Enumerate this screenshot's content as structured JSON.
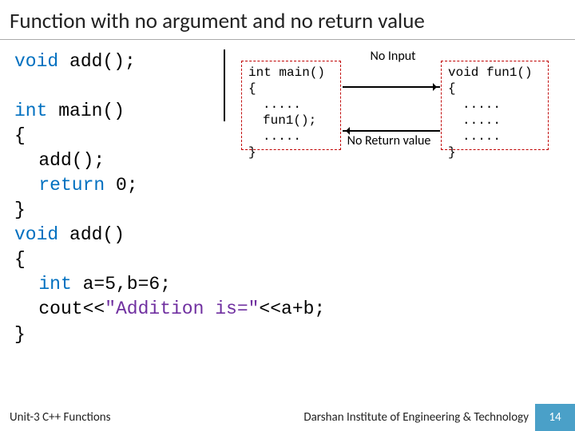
{
  "title": "Function with no argument and no return value",
  "code": {
    "l1_kw": "void",
    "l1_rest": " add();",
    "l2_blank": "",
    "l3_kw": "int",
    "l3_rest": " main()",
    "l4": "{",
    "l5": "add();",
    "l6_kw": "return",
    "l6_rest": " 0;",
    "l7": "}",
    "l8_kw": "void",
    "l8_rest": " add()",
    "l9": "{",
    "l10_kw": "int",
    "l10_rest": " a=5,b=6;",
    "l11a": "cout<<",
    "l11_str": "\"Addition is=\"",
    "l11b": "<<a+b;",
    "l12": "}"
  },
  "diagram": {
    "caller": {
      "sig": "int main()",
      "open": "{",
      "dots1": ".....",
      "call": "fun1();",
      "dots2": ".....",
      "close": "}"
    },
    "callee": {
      "sig": "void fun1()",
      "open": "{",
      "dots1": ".....",
      "dots2": ".....",
      "dots3": ".....",
      "close": "}"
    },
    "label_top": "No Input",
    "label_bottom": "No Return value"
  },
  "footer": {
    "unit": "Unit-3 C++ Functions",
    "institute": "Darshan Institute of Engineering & Technology",
    "page": "14"
  }
}
